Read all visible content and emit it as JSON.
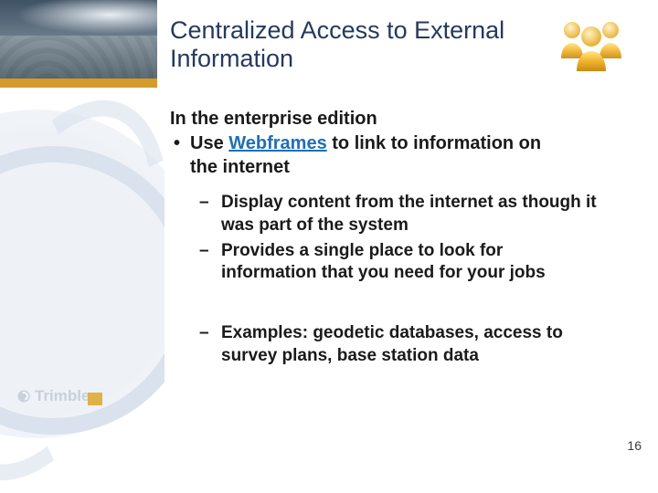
{
  "title": "Centralized Access to External Information",
  "header_icon": "people-group-icon",
  "lead": "In the enterprise edition",
  "bullet1_pre": "Use ",
  "bullet1_link": "Webframes",
  "bullet1_post": " to link to information on the internet",
  "sub_bullets": [
    "Display content from the internet as though it was part of the system",
    "Provides a single place to look for information that you need for your jobs",
    "Examples: geodetic databases, access to survey plans, base station data"
  ],
  "brand": "Trimble.",
  "page_number": "16",
  "colors": {
    "title": "#243a5e",
    "link": "#1f6fb5",
    "accent_gold": "#d49a2c"
  }
}
